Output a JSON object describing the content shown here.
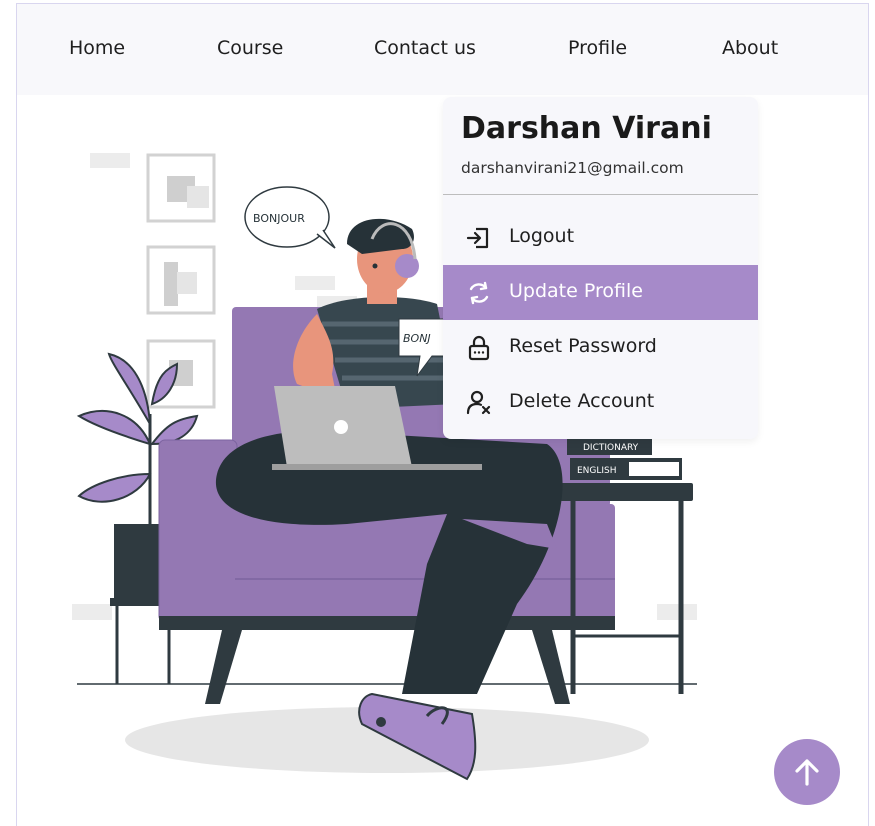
{
  "nav": {
    "items": [
      {
        "label": "Home"
      },
      {
        "label": "Course"
      },
      {
        "label": "Contact us"
      },
      {
        "label": "Profile"
      },
      {
        "label": "About"
      }
    ]
  },
  "illustration": {
    "bubble_large": "BONJOUR",
    "bubble_small": "BONJ",
    "book_top": "DICTIONARY",
    "book_bottom": "ENGLISH"
  },
  "profile_menu": {
    "name": "Darshan Virani",
    "email": "darshanvirani21@gmail.com",
    "items": [
      {
        "label": "Logout",
        "icon": "logout-icon"
      },
      {
        "label": "Update Profile",
        "icon": "refresh-icon",
        "active": true
      },
      {
        "label": "Reset Password",
        "icon": "lock-icon"
      },
      {
        "label": "Delete Account",
        "icon": "user-remove-icon"
      }
    ]
  },
  "colors": {
    "accent": "#a68ac9",
    "nav_bg": "#f8f8fb",
    "dark": "#2f3a40"
  },
  "scroll_top": {
    "icon": "arrow-up-icon"
  }
}
